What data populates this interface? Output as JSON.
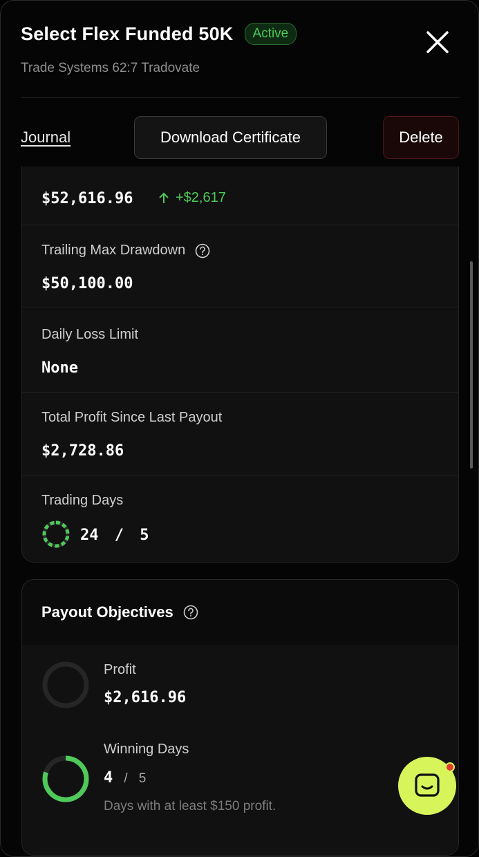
{
  "header": {
    "title": "Select Flex Funded 50K",
    "status_badge": "Active",
    "subtitle": "Trade Systems 62:7 Tradovate"
  },
  "actions": {
    "journal_label": "Journal",
    "download_label": "Download Certificate",
    "delete_label": "Delete"
  },
  "stats": {
    "balance": {
      "value": "$52,616.96",
      "delta": "+$2,617"
    },
    "trailing_drawdown": {
      "label": "Trailing Max Drawdown",
      "value": "$50,100.00"
    },
    "daily_loss": {
      "label": "Daily Loss Limit",
      "value": "None"
    },
    "total_profit": {
      "label": "Total Profit Since Last Payout",
      "value": "$2,728.86"
    },
    "trading_days": {
      "label": "Trading Days",
      "current": "24",
      "separator": "/",
      "target": "5",
      "progress": 1.0
    }
  },
  "payout_objectives": {
    "title": "Payout Objectives",
    "profit": {
      "label": "Profit",
      "value": "$2,616.96",
      "progress": 0.0
    },
    "winning_days": {
      "label": "Winning Days",
      "current": "4",
      "separator": "/",
      "target": "5",
      "note": "Days with at least $150 profit.",
      "progress": 0.8
    }
  },
  "colors": {
    "accent_green": "#4ec95a",
    "chat_button": "#d7f55a",
    "notification_dot": "#e23b30"
  },
  "icons": {
    "close": "close-icon",
    "help": "help-circle-icon",
    "arrow_up": "arrow-up-icon",
    "chat": "chat-icon"
  }
}
